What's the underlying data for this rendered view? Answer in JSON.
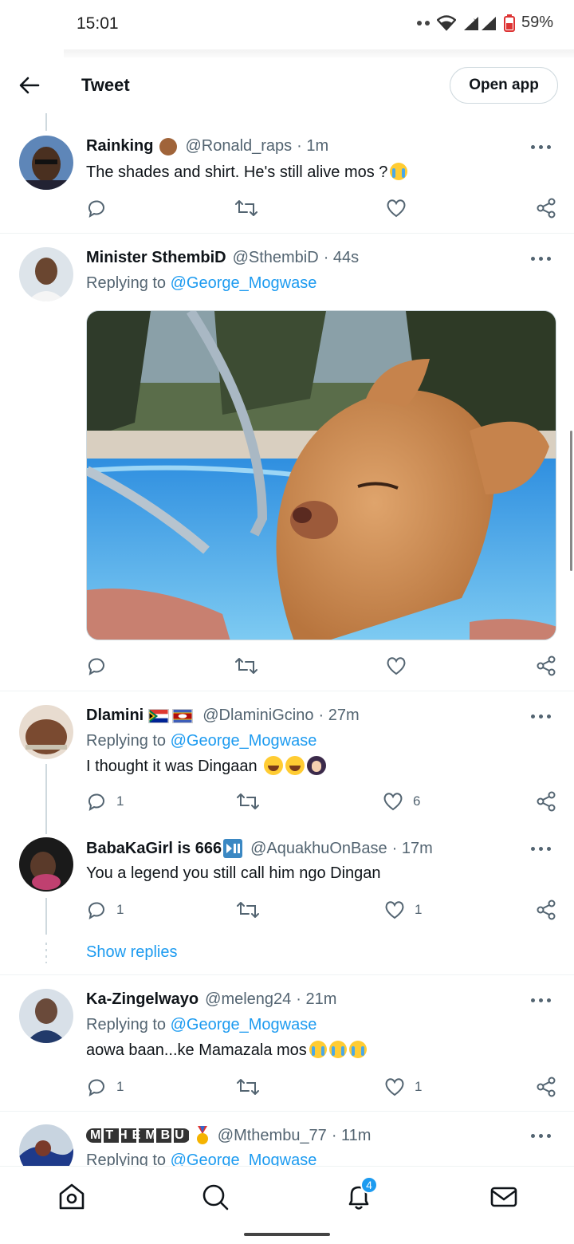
{
  "status_bar": {
    "time": "15:01",
    "battery": "59%"
  },
  "header": {
    "title": "Tweet",
    "open_app": "Open app"
  },
  "tweets": [
    {
      "name": "Rainking",
      "handle": "@Ronald_raps",
      "time": "· 1m",
      "text": "The shades and shirt. He's still alive mos ?",
      "reply_count": "",
      "retweet_count": "",
      "like_count": ""
    },
    {
      "name": "Minister SthembiD",
      "handle": "@SthembiD",
      "time": "· 44s",
      "replying_prefix": "Replying to",
      "replying_to": "@George_Mogwase",
      "media": "dog-in-pool-image"
    },
    {
      "name": "Dlamini",
      "handle": "@DlaminiGcino",
      "time": "· 27m",
      "replying_prefix": "Replying to",
      "replying_to": "@George_Mogwase",
      "text": "I thought it was Dingaan",
      "reply_count": "1",
      "like_count": "6"
    },
    {
      "name": "BabaKaGirl is 666",
      "handle": "@AquakhuOnBase",
      "time": "· 17m",
      "text": "You a legend you still call him ngo Dingan",
      "reply_count": "1",
      "like_count": "1",
      "show_replies": "Show replies"
    },
    {
      "name": "Ka-Zingelwayo",
      "handle": "@meleng24",
      "time": "· 21m",
      "replying_prefix": "Replying to",
      "replying_to": "@George_Mogwase",
      "text": "aowa baan...ke Mamazala mos",
      "reply_count": "1",
      "like_count": "1"
    },
    {
      "name": "MTHEMBU",
      "handle": "@Mthembu_77",
      "time": "· 11m",
      "replying_prefix": "Replying to",
      "replying_to": "@George_Mogwase"
    }
  ],
  "bottom_nav": {
    "notification_badge": "4"
  },
  "colors": {
    "link": "#1d9bf0",
    "secondary_text": "#536471",
    "divider": "#eff3f4"
  }
}
